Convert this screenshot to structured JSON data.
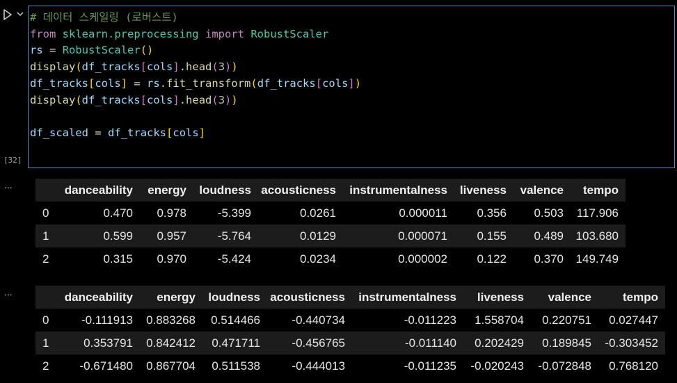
{
  "cell": {
    "execution_count": "[32]",
    "code_lines": [
      "# 데이터 스케일링 (로버스트)",
      "from sklearn.preprocessing import RobustScaler",
      "rs = RobustScaler()",
      "display(df_tracks[cols].head(3))",
      "df_tracks[cols] = rs.fit_transform(df_tracks[cols])",
      "display(df_tracks[cols].head(3))",
      "",
      "df_scaled = df_tracks[cols]"
    ]
  },
  "outputs": {
    "ellipsis": "...",
    "table1": {
      "columns": [
        "danceability",
        "energy",
        "loudness",
        "acousticness",
        "instrumentalness",
        "liveness",
        "valence",
        "tempo"
      ],
      "rows": [
        {
          "index": "0",
          "values": [
            "0.470",
            "0.978",
            "-5.399",
            "0.0261",
            "0.000011",
            "0.356",
            "0.503",
            "117.906"
          ]
        },
        {
          "index": "1",
          "values": [
            "0.599",
            "0.957",
            "-5.764",
            "0.0129",
            "0.000071",
            "0.155",
            "0.489",
            "103.680"
          ]
        },
        {
          "index": "2",
          "values": [
            "0.315",
            "0.970",
            "-5.424",
            "0.0234",
            "0.000002",
            "0.122",
            "0.370",
            "149.749"
          ]
        }
      ]
    },
    "table2": {
      "columns": [
        "danceability",
        "energy",
        "loudness",
        "acousticness",
        "instrumentalness",
        "liveness",
        "valence",
        "tempo"
      ],
      "rows": [
        {
          "index": "0",
          "values": [
            "-0.111913",
            "0.883268",
            "0.514466",
            "-0.440734",
            "-0.011223",
            "1.558704",
            "0.220751",
            "0.027447"
          ]
        },
        {
          "index": "1",
          "values": [
            "0.353791",
            "0.842412",
            "0.471711",
            "-0.456765",
            "-0.011140",
            "0.202429",
            "0.189845",
            "-0.303452"
          ]
        },
        {
          "index": "2",
          "values": [
            "-0.671480",
            "0.867704",
            "0.511538",
            "-0.444013",
            "-0.011235",
            "-0.020243",
            "-0.072848",
            "0.768120"
          ]
        }
      ]
    }
  },
  "icons": {
    "run": "play-icon",
    "collapse": "chevron-down-icon"
  },
  "colors": {
    "cell_border": "#4f8fc7",
    "background": "#000000",
    "comment": "#6a9955",
    "keyword": "#c586c0",
    "class": "#4ec9b0",
    "variable": "#9cdcfe",
    "function": "#dcdcaa",
    "number": "#b5cea8"
  }
}
